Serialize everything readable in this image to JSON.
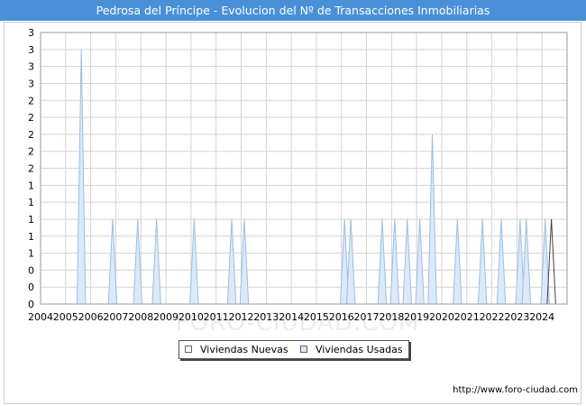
{
  "header": {
    "title": "Pedrosa del Príncipe - Evolucion del Nº de Transacciones Inmobiliarias"
  },
  "footer": {
    "url": "http://www.foro-ciudad.com"
  },
  "watermark": "FORO-CIUDAD.COM",
  "legend": {
    "items": [
      {
        "label": "Viviendas Nuevas",
        "color": "#ffffff"
      },
      {
        "label": "Viviendas Usadas",
        "color": "#dbe9fa"
      }
    ]
  },
  "colors": {
    "title_bg": "#4a90d9",
    "usadas_fill": "#dbe9fa",
    "usadas_stroke": "#9fbde0",
    "nuevas_stroke": "#444444",
    "grid": "#d3d3d3"
  },
  "chart_data": {
    "type": "area",
    "title": "Pedrosa del Príncipe - Evolucion del Nº de Transacciones Inmobiliarias",
    "xlabel": "",
    "ylabel": "",
    "x_ticks": [
      "2004",
      "2005",
      "2006",
      "2007",
      "2008",
      "2009",
      "2010",
      "2011",
      "2012",
      "2013",
      "2014",
      "2015",
      "2016",
      "2017",
      "2018",
      "2019",
      "2020",
      "2021",
      "2022",
      "2023",
      "2024"
    ],
    "y_tick_labels": [
      "0",
      "0",
      "0",
      "1",
      "1",
      "1",
      "1",
      "1",
      "2",
      "2",
      "2",
      "2",
      "2",
      "3",
      "3",
      "3",
      "3"
    ],
    "ylim": [
      0,
      3.2
    ],
    "grid": true,
    "legend_position": "bottom-center",
    "series": [
      {
        "name": "Viviendas Usadas",
        "quarters": [
          [
            "2005-Q3",
            3
          ],
          [
            "2006-Q4",
            1
          ],
          [
            "2007-Q4",
            1
          ],
          [
            "2008-Q3",
            1
          ],
          [
            "2010-Q1",
            1
          ],
          [
            "2011-Q3",
            1
          ],
          [
            "2012-Q1",
            1
          ],
          [
            "2016-Q1",
            1
          ],
          [
            "2016-Q2",
            1
          ],
          [
            "2017-Q3",
            1
          ],
          [
            "2018-Q1",
            1
          ],
          [
            "2018-Q3",
            1
          ],
          [
            "2019-Q1",
            1
          ],
          [
            "2019-Q3",
            2
          ],
          [
            "2020-Q3",
            1
          ],
          [
            "2021-Q3",
            1
          ],
          [
            "2022-Q2",
            1
          ],
          [
            "2023-Q1",
            1
          ],
          [
            "2023-Q2",
            1
          ],
          [
            "2024-Q1",
            1
          ]
        ]
      },
      {
        "name": "Viviendas Nuevas",
        "quarters": [
          [
            "2024-Q2",
            1
          ]
        ]
      }
    ]
  }
}
